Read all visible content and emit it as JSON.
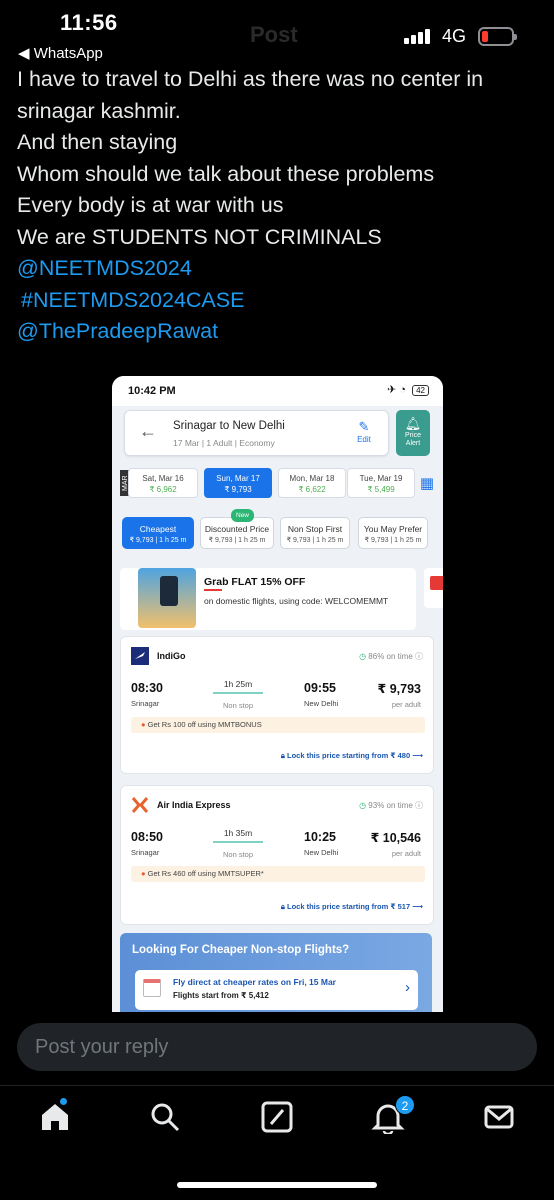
{
  "status_bar": {
    "time": "11:56",
    "back_label": "◀ WhatsApp",
    "network": "4G",
    "ghost_title": "Post"
  },
  "tweet": {
    "lines": [
      "I have to travel to Delhi as there was no center in",
      "srinagar kashmir.",
      "And then staying",
      "Whom should we talk about these problems",
      "Every body is at war with us",
      "We are STUDENTS NOT CRIMINALS"
    ],
    "tags": [
      "@NEETMDS2024",
      "#NEETMDS2024CASE",
      "@ThePradeepRawat"
    ]
  },
  "screenshot": {
    "phone_time": "10:42 PM",
    "phone_battery": "42",
    "route": {
      "title": "Srinagar to New Delhi",
      "subtitle": "17 Mar | 1 Adult | Economy",
      "edit_label": "Edit",
      "price_alert_line1": "Price",
      "price_alert_line2": "Alert"
    },
    "month_tag": "MAR",
    "dates": [
      {
        "day": "Sat, Mar 16",
        "price": "₹ 6,962"
      },
      {
        "day": "Sun, Mar 17",
        "price": "₹ 9,793",
        "selected": true
      },
      {
        "day": "Mon, Mar 18",
        "price": "₹ 6,622"
      },
      {
        "day": "Tue, Mar 19",
        "price": "₹ 5,499"
      }
    ],
    "filters": [
      {
        "label": "Cheapest",
        "sub": "₹ 9,793 | 1 h 25 m",
        "selected": true
      },
      {
        "label": "Discounted Price",
        "sub": "₹ 9,793 | 1 h 25 m",
        "badge": "New"
      },
      {
        "label": "Non Stop First",
        "sub": "₹ 9,793 | 1 h 25 m"
      },
      {
        "label": "You May Prefer",
        "sub": "₹ 9,793 | 1 h 25 m"
      }
    ],
    "promo": {
      "title": "Grab FLAT 15% OFF",
      "subtitle": "on domestic flights, using code: WELCOMEMMT"
    },
    "flights": [
      {
        "airline": "IndiGo",
        "on_time": "86% on time",
        "dep_time": "08:30",
        "dep_city": "Srinagar",
        "duration": "1h 25m",
        "stops": "Non stop",
        "arr_time": "09:55",
        "arr_city": "New Delhi",
        "price": "₹ 9,793",
        "per": "per adult",
        "offer": "Get Rs 100 off using MMTBONUS",
        "lock": "Lock this price starting from ₹ 480"
      },
      {
        "airline": "Air India Express",
        "on_time": "93% on time",
        "dep_time": "08:50",
        "dep_city": "Srinagar",
        "duration": "1h 35m",
        "stops": "Non stop",
        "arr_time": "10:25",
        "arr_city": "New Delhi",
        "price": "₹ 10,546",
        "per": "per adult",
        "offer": "Get Rs 460 off using MMTSUPER*",
        "lock": "Lock this price starting from ₹ 517"
      }
    ],
    "cheaper": {
      "title": "Looking For Cheaper Non-stop Flights?",
      "line1": "Fly direct at cheaper rates on Fri, 15 Mar",
      "line2": "Flights start from ₹ 5,412"
    }
  },
  "reply": {
    "placeholder": "Post your reply"
  },
  "nav": {
    "notifications_badge": "2"
  },
  "colors": {
    "link": "#1d9bf0",
    "mmt_blue": "#1a73e8",
    "teal": "#3a9c8f"
  }
}
